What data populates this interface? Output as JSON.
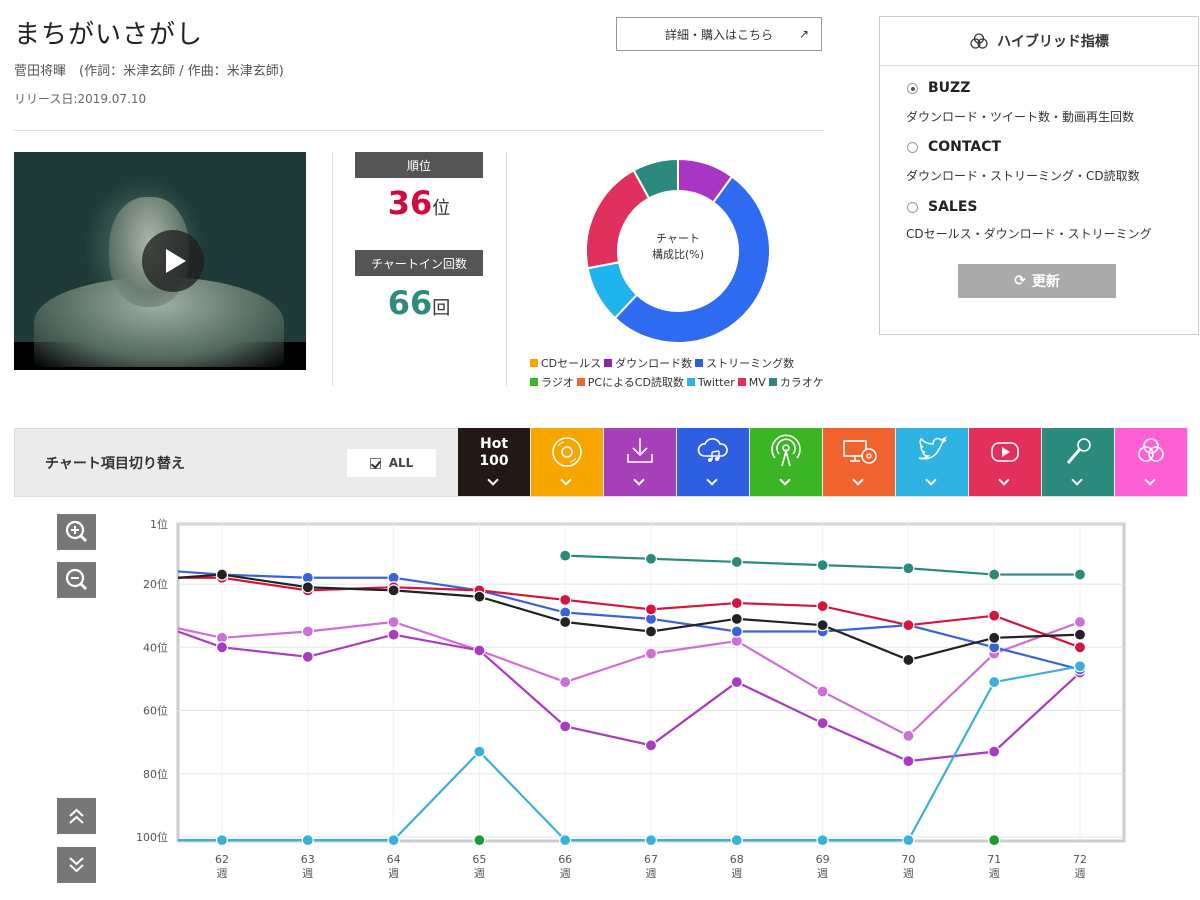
{
  "song": {
    "title": "まちがいさがし",
    "artist_line": "菅田将暉　(作詞：米津玄師 / 作曲：米津玄師)",
    "release": "リリース日:2019.07.10"
  },
  "detail_button": {
    "label": "詳細・購入はこちら",
    "arrow": "↗"
  },
  "stats": {
    "rank_label": "順位",
    "rank_number": "36",
    "rank_unit": "位",
    "chartin_label": "チャートイン回数",
    "chartin_number": "66",
    "chartin_unit": "回"
  },
  "hybrid": {
    "title": "ハイブリッド指標",
    "options": [
      {
        "name": "BUZZ",
        "desc": "ダウンロード・ツイート数・動画再生回数",
        "selected": true
      },
      {
        "name": "CONTACT",
        "desc": "ダウンロード・ストリーミング・CD読取数",
        "selected": false
      },
      {
        "name": "SALES",
        "desc": "CDセールス・ダウンロード・ストリーミング",
        "selected": false
      }
    ],
    "update_label": "更新",
    "update_icon": "refresh-icon"
  },
  "switch_bar": {
    "title": "チャート項目切り替え",
    "all_label": "ALL",
    "tabs": [
      {
        "id": "hot100",
        "label": "Hot 100",
        "line1": "Hot",
        "line2": "100",
        "color": "#231816",
        "icon": "hot100"
      },
      {
        "id": "cd",
        "color": "#f7a600",
        "icon": "cd-icon"
      },
      {
        "id": "download",
        "color": "#a640b8",
        "icon": "download-icon"
      },
      {
        "id": "streaming",
        "color": "#2e5fe0",
        "icon": "cloud-music-icon"
      },
      {
        "id": "radio",
        "color": "#3bb524",
        "icon": "radio-icon"
      },
      {
        "id": "pc",
        "color": "#f0632e",
        "icon": "pc-cd-icon"
      },
      {
        "id": "twitter",
        "color": "#2fb3e3",
        "icon": "twitter-icon"
      },
      {
        "id": "mv",
        "color": "#e2305a",
        "icon": "youtube-icon"
      },
      {
        "id": "karaoke",
        "color": "#2a8a7c",
        "icon": "microphone-icon"
      },
      {
        "id": "hybrid",
        "color": "#ff5fd4",
        "icon": "hybrid-icon"
      }
    ]
  },
  "chart_data": [
    {
      "type": "pie",
      "title": "チャート\n構成比(%)",
      "donut": true,
      "slices": [
        {
          "name": "ダウンロード数",
          "value": 10,
          "color": "#a835c4"
        },
        {
          "name": "ストリーミング数",
          "value": 52,
          "color": "#2f6bf0"
        },
        {
          "name": "Twitter",
          "value": 10,
          "color": "#1fb4ee"
        },
        {
          "name": "MV",
          "value": 20,
          "color": "#e0305e"
        },
        {
          "name": "カラオケ",
          "value": 8,
          "color": "#2b8a7d"
        }
      ],
      "legend": [
        {
          "name": "CDセールス",
          "color": "#f7a600"
        },
        {
          "name": "ダウンロード数",
          "color": "#8e24aa"
        },
        {
          "name": "ストリーミング数",
          "color": "#2e5fe0"
        },
        {
          "name": "ラジオ",
          "color": "#3bb524"
        },
        {
          "name": "PCによるCD読取数",
          "color": "#f0632e"
        },
        {
          "name": "Twitter",
          "color": "#2fb3e3"
        },
        {
          "name": "MV",
          "color": "#e2305a"
        },
        {
          "name": "カラオケ",
          "color": "#2a8a7c"
        }
      ]
    },
    {
      "type": "line",
      "x": [
        "62\n週",
        "63\n週",
        "64\n週",
        "65\n週",
        "66\n週",
        "67\n週",
        "68\n週",
        "69\n週",
        "70\n週",
        "71\n週",
        "72\n週"
      ],
      "y_ticks": [
        "1位",
        "20位",
        "40位",
        "60位",
        "80位",
        "100位"
      ],
      "y_tick_values": [
        1,
        20,
        40,
        60,
        80,
        100
      ],
      "ylim": [
        1,
        101
      ],
      "y_inverted": true,
      "grid": true,
      "series": [
        {
          "color": "#cc6fd6",
          "values": [
            37,
            35,
            32,
            41,
            51,
            42,
            38,
            54,
            68,
            42,
            32
          ],
          "lead": 34
        },
        {
          "color": "#a83bc0",
          "values": [
            40,
            43,
            36,
            41,
            65,
            71,
            51,
            64,
            76,
            73,
            48
          ],
          "lead": 35
        },
        {
          "color": "#3a63d8",
          "values": [
            17,
            18,
            18,
            22,
            29,
            31,
            35,
            35,
            33,
            40,
            47
          ],
          "lead": 16
        },
        {
          "color": "#d6153f",
          "values": [
            18,
            22,
            21,
            22,
            25,
            28,
            26,
            27,
            33,
            30,
            40
          ],
          "lead": 18
        },
        {
          "color": "#222222",
          "values": [
            17,
            21,
            22,
            24,
            32,
            35,
            31,
            33,
            44,
            37,
            36
          ],
          "lead": 18
        },
        {
          "color": "#3ab1d6",
          "values": [
            101,
            101,
            101,
            73,
            101,
            101,
            101,
            101,
            101,
            51,
            46
          ],
          "lead": 101
        },
        {
          "color": "#2a8a7c",
          "values": [
            null,
            null,
            null,
            null,
            11,
            12,
            13,
            14,
            15,
            17,
            17
          ]
        },
        {
          "color": "#1e9a34",
          "values": [
            null,
            null,
            null,
            101,
            null,
            null,
            null,
            null,
            null,
            101,
            null
          ],
          "markers_only": true
        }
      ]
    }
  ]
}
